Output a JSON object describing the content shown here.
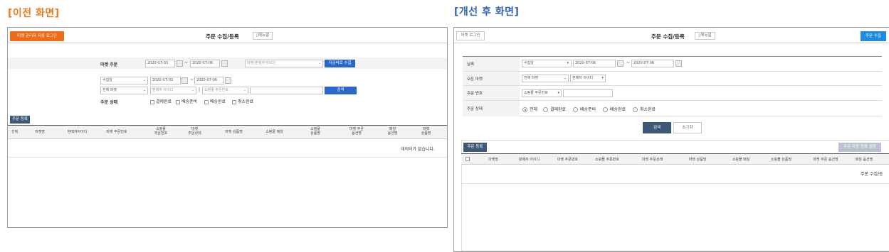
{
  "headings": {
    "before": "[이전 화면]",
    "after": "[개선 후 화면]"
  },
  "colors": {
    "before_heading": "#f07b20",
    "after_heading": "#2f63b8",
    "orange_button": "#ee6b1a",
    "blue_button": "#2a67c9",
    "dark_button": "#3f5877"
  },
  "before": {
    "auto_login_button": "마켓 관리자 자동 로그인",
    "title": "주문 수집/등록",
    "manual_button": "매뉴얼",
    "market_order_label": "마켓 주문",
    "date_from": "2020-07-03",
    "date_to": "2020-07-06",
    "tilde": "~",
    "market_select_placeholder": "마켓(판매자아이디)",
    "collect_now_button": "지금바로 수집",
    "date_type_select": "수집일",
    "filter_date_from": "2020-07-03",
    "filter_date_to": "2020-07-06",
    "all_market_select": "전체 마켓",
    "seller_id_select": "판매자 아이디",
    "bar": "|",
    "mall_order_select": "쇼핑몰 주문번호",
    "search_button": "검색",
    "order_status_label": "주문 상태",
    "status_options": [
      "결제완료",
      "배송준비",
      "배송완료",
      "취소완료"
    ],
    "order_register_button": "주문 등록",
    "columns": [
      "선택",
      "마켓명",
      "판매자아이디",
      "마켓 주문번호",
      "쇼핑몰\n주문번호",
      "마켓\n주문상태",
      "마켓 상품명",
      "쇼핑몰 매칭",
      "쇼핑몰\n상품명",
      "마켓 주문\n옵션명",
      "매칭\n옵션명",
      "마켓\n상품명"
    ],
    "empty_message": "데이터가 없습니다."
  },
  "after": {
    "market_login_button": "마켓 로그인",
    "title": "주문 수집/등록",
    "manual_button": "매뉴얼",
    "order_collect_button": "주문 수집",
    "date_label": "날짜",
    "date_type_select": "수집일",
    "date_from": "2020-07-06",
    "date_to": "2020-07-06",
    "tilde": "~",
    "open_market_label": "오픈 마켓",
    "all_market_select": "전체 마켓",
    "seller_id_select": "판매자 아이디",
    "order_no_label": "주문 번호",
    "mall_order_select": "쇼핑몰 주문번호",
    "order_status_label": "주문 상태",
    "status_options": [
      "전체",
      "결제완료",
      "배송준비",
      "배송완료",
      "취소완료"
    ],
    "search_button": "검색",
    "reset_button": "초기화",
    "order_register_button": "주문 등록",
    "auto_register_setting_button": "주문 자동 등록 설정",
    "columns": [
      "마켓명",
      "판매자 아이디",
      "마켓 주문번호",
      "쇼핑몰 주문번호",
      "마켓 주문상태",
      "마켓 상품명",
      "쇼핑몰 매칭",
      "쇼핑몰 상품명",
      "마켓 주문 옵션명",
      "매칭 옵션명"
    ],
    "empty_message": "주문 수집/등"
  }
}
